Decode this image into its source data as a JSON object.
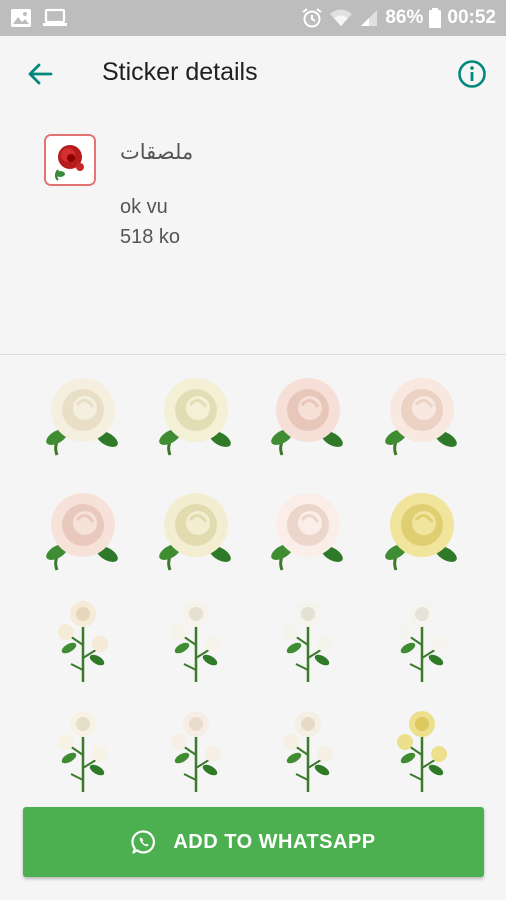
{
  "status_bar": {
    "battery": "86%",
    "time": "00:52"
  },
  "app_bar": {
    "title": "Sticker details"
  },
  "pack": {
    "name": "ملصقات",
    "author": "ok vu",
    "size": "518 ko"
  },
  "stickers": [
    {
      "name": "white-rose-large"
    },
    {
      "name": "cream-rose-leaves"
    },
    {
      "name": "pink-rose"
    },
    {
      "name": "peach-rose-leaves"
    },
    {
      "name": "pink-rose-side"
    },
    {
      "name": "cream-rose-stem"
    },
    {
      "name": "rose-sprig"
    },
    {
      "name": "yellow-rose-bouquet"
    },
    {
      "name": "cream-roses-cluster"
    },
    {
      "name": "white-rose-stem"
    },
    {
      "name": "white-rose-branch"
    },
    {
      "name": "white-flower-branch"
    },
    {
      "name": "white-rose-bouquet"
    },
    {
      "name": "rose-branch-diagonal"
    },
    {
      "name": "rose-bush"
    },
    {
      "name": "yellow-rose-wreath"
    }
  ],
  "add_button": {
    "label": "ADD TO WHATSAPP"
  },
  "colors": {
    "accent": "#00897b",
    "button": "#4caf50",
    "status_bar": "#bdbdbd"
  }
}
